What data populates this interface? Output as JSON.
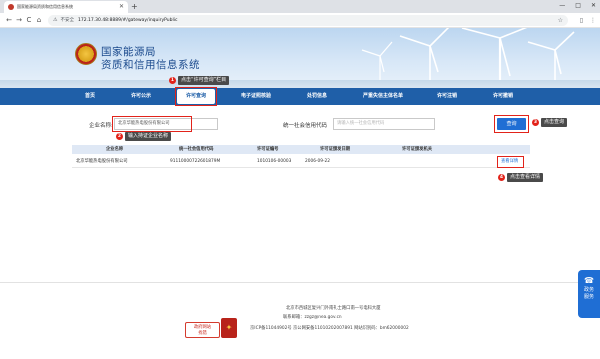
{
  "browser": {
    "tab_title": "国家能源局资质和信用信息系统",
    "new_tab": "+",
    "win_controls": [
      "—",
      "□",
      "✕"
    ],
    "url": "172.17.30.48:8889/#/gateway/inquiryPublic",
    "not_secure": "不安全",
    "nav_buttons": [
      "←",
      "→",
      "C",
      "⌂"
    ],
    "toolbar_icons": [
      "☆",
      "▯",
      "⋮"
    ]
  },
  "header": {
    "title_line1": "国家能源局",
    "title_line2": "资质和信用信息系统"
  },
  "nav": {
    "items": [
      "首页",
      "许可公示",
      "许可查询",
      "电子证照核验",
      "处罚信息",
      "严重失信主体名单",
      "许可注销",
      "许可撤销"
    ],
    "active_index": 2
  },
  "annotations": [
    {
      "num": "1",
      "text": "点击“许可查询”栏目"
    },
    {
      "num": "2",
      "text": "输入持证企业名称"
    },
    {
      "num": "3",
      "text": "点击查询"
    },
    {
      "num": "4",
      "text": "点击查看详情"
    }
  ],
  "search": {
    "company_label": "企业名称:",
    "company_value": "北京华能热电股份有限公司",
    "credit_label": "统一社会信用代码",
    "credit_placeholder": "请输入统一社会信用代码",
    "button": "查询"
  },
  "table": {
    "headers": [
      "企业名称",
      "统一社会信用代码",
      "许可证编号",
      "许可证颁发日期",
      "许可证颁发机关"
    ],
    "rows": [
      [
        "北京华能热电股份有限公司",
        "91110000722601879M",
        "1010106-00003",
        "2006-09-22",
        ""
      ]
    ],
    "detail_link": "查看详情"
  },
  "float_service": {
    "icon": "☎",
    "line1": "政务",
    "line2": "服务"
  },
  "footer": {
    "address": "北京市西城区复兴门外南礼士路口南一号电科大厦",
    "email": "联系邮箱：zzgz@nea.gov.cn",
    "icp": "京ICP备11044902号 京公网安备11010202007891 网站识别码：bm62000002",
    "gov_logo_line1": "政府网站",
    "gov_logo_line2": "找错",
    "police_icon": "✦"
  }
}
